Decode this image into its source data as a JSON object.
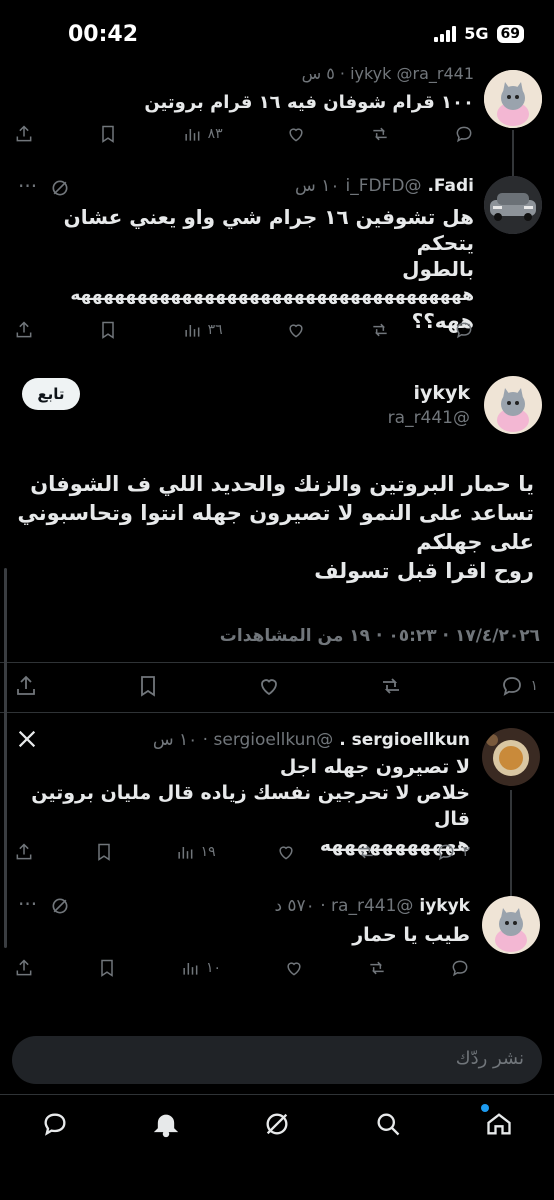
{
  "status_bar": {
    "time": "00:42",
    "network": "5G",
    "battery": "69"
  },
  "tweets": [
    {
      "id": "t1",
      "header": "iykyk @ra_r441 · ٥ س",
      "text": "١٠٠ قرام شوفان فيه ١٦ قرام بروتين",
      "views": "٨٣",
      "avatar_icon": "cat-avatar-icon"
    },
    {
      "id": "t2",
      "name": "Fadi.",
      "handle": "@i_FDFD",
      "time": "١٠ س",
      "text_lines": [
        "هل تشوفين ١٦ جرام شي واو يعني عشان يتحكم",
        "بالطول",
        "هههههههههههههههههههههههههههههههههههه",
        "ههه؟؟"
      ],
      "views": "٣٦",
      "avatar_icon": "car-avatar-icon"
    }
  ],
  "main_tweet": {
    "name": "iykyk",
    "handle": "@ra_r441",
    "follow_label": "تابع",
    "text_lines": [
      "يا حمار البروتين والزنك والحديد اللي ف الشوفان",
      "تساعد على النمو لا تصيرون جهله انتوا وتحاسبوني",
      "على جهلكم",
      "روح اقرا قبل تسولف"
    ],
    "meta": "١٧/٤/٢٠٢٦ · ٠٥:٢٣ · ١٩ من المشاهدات",
    "replies": "١"
  },
  "replies": [
    {
      "id": "r1",
      "name": "sergioellkun .",
      "handle_time": "@sergioellkun · ١٠ س",
      "text_lines": [
        "لا تصيرون جهله اجل",
        "خلاص لا تحرجين نفسك زياده قال مليان بروتين قال",
        "هههههههههههه"
      ],
      "views": "١٩",
      "reply_count": "٣",
      "platform_icon": "x-logo-icon"
    },
    {
      "id": "r2",
      "name": "iykyk",
      "handle_time": "@ra_r441 · ٥٧٠ د",
      "text": "طيب يا حمار",
      "views": "١٠"
    }
  ],
  "reply_box": {
    "placeholder": "نشر ردّك"
  },
  "bottom_nav": [
    "chat-icon",
    "bell-icon",
    "grok-icon",
    "search-icon",
    "home-icon"
  ],
  "colors": {
    "background": "#000000",
    "text": "#e7e9ea",
    "muted": "#71767b",
    "accent": "#1d9bf0"
  }
}
